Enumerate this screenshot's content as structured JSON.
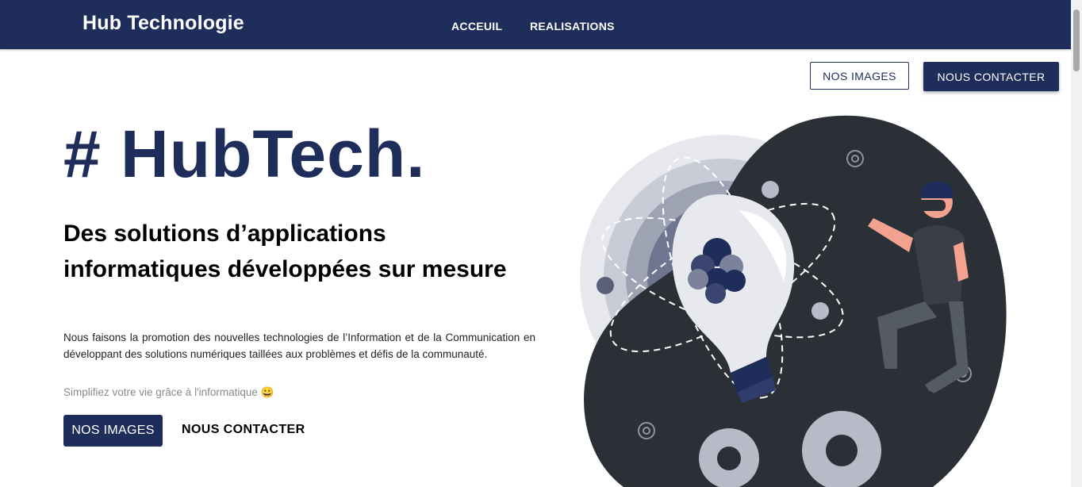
{
  "navbar": {
    "brand": "Hub Technologie",
    "links": [
      "ACCEUIL",
      "REALISATIONS"
    ]
  },
  "top_actions": {
    "images_label": "NOS IMAGES",
    "contact_label": "NOUS CONTACTER"
  },
  "hero": {
    "title": "# HubTech.",
    "subtitle": "Des solutions d’applications informatiques développées sur mesure",
    "description": "Nous faisons la promotion des nouvelles technologies de l’Information et de la Communication en développant des solutions numériques taillées aux problèmes et défis de la communauté.",
    "tagline": "Simplifiez votre vie grâce à l'informatique 😀",
    "cta_images": "NOS IMAGES",
    "cta_contact": "NOUS CONTACTER"
  },
  "illustration": {
    "icons": [
      "lightbulb-icon",
      "atom-icon",
      "gear-icon",
      "vr-person-icon"
    ]
  },
  "colors": {
    "primary": "#1e2d5a",
    "dark_blob": "#2b3036",
    "light_circle": "#d4d7df"
  }
}
